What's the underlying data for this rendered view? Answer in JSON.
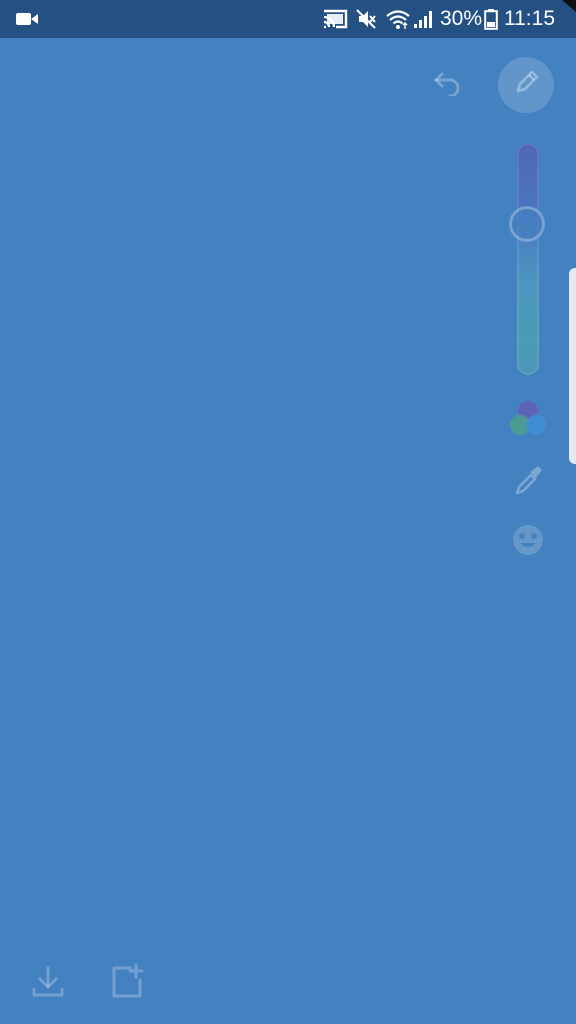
{
  "status_bar": {
    "battery_text": "30%",
    "time": "11:15",
    "icons": [
      "video-camera-icon",
      "cast-icon",
      "mute-icon",
      "wifi-icon",
      "signal-icon",
      "battery-icon"
    ]
  },
  "toolbar": {
    "tools": [
      "undo-icon",
      "pencil-icon",
      "brush-size-slider",
      "color-palette-icon",
      "eyedropper-icon",
      "emoji-icon"
    ],
    "brush_size_fraction": 0.35
  },
  "bottom_bar": {
    "actions": [
      "download-icon",
      "add-page-icon"
    ]
  },
  "colors": {
    "canvas": "#4481c0",
    "status_bar": "#245083"
  }
}
